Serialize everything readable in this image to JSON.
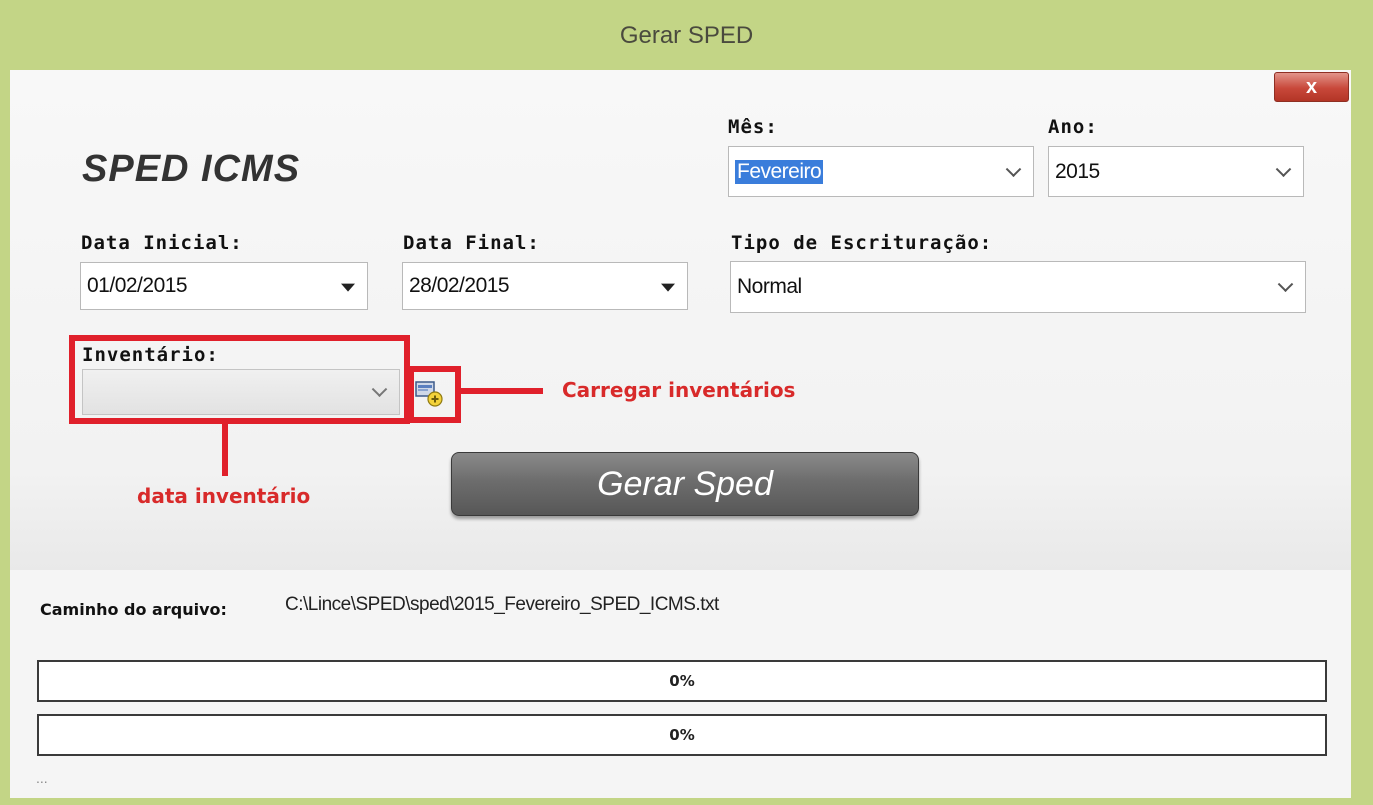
{
  "window": {
    "title": "Gerar SPED",
    "close_label": "x"
  },
  "header": {
    "title": "SPED ICMS"
  },
  "fields": {
    "mes": {
      "label": "Mês:",
      "value": "Fevereiro"
    },
    "ano": {
      "label": "Ano:",
      "value": "2015"
    },
    "data_inicial": {
      "label": "Data Inicial:",
      "value": "01/02/2015"
    },
    "data_final": {
      "label": "Data Final:",
      "value": "28/02/2015"
    },
    "tipo": {
      "label": "Tipo de Escrituração:",
      "value": "Normal"
    },
    "inventario": {
      "label": "Inventário:",
      "value": ""
    }
  },
  "annotations": {
    "carregar": "Carregar inventários",
    "data_inventario": "data inventário"
  },
  "actions": {
    "gerar_label": "Gerar Sped"
  },
  "output": {
    "path_label": "Caminho do arquivo:",
    "path_value": "C:\\Lince\\SPED\\sped\\2015_Fevereiro_SPED_ICMS.txt"
  },
  "progress": [
    {
      "label": "0%",
      "value": 0
    },
    {
      "label": "0%",
      "value": 0
    }
  ],
  "status": {
    "text": "..."
  },
  "colors": {
    "frame": "#c3d586",
    "annotation": "#e0202b",
    "selection": "#3a7ddb",
    "button": "#6d6d6d"
  }
}
